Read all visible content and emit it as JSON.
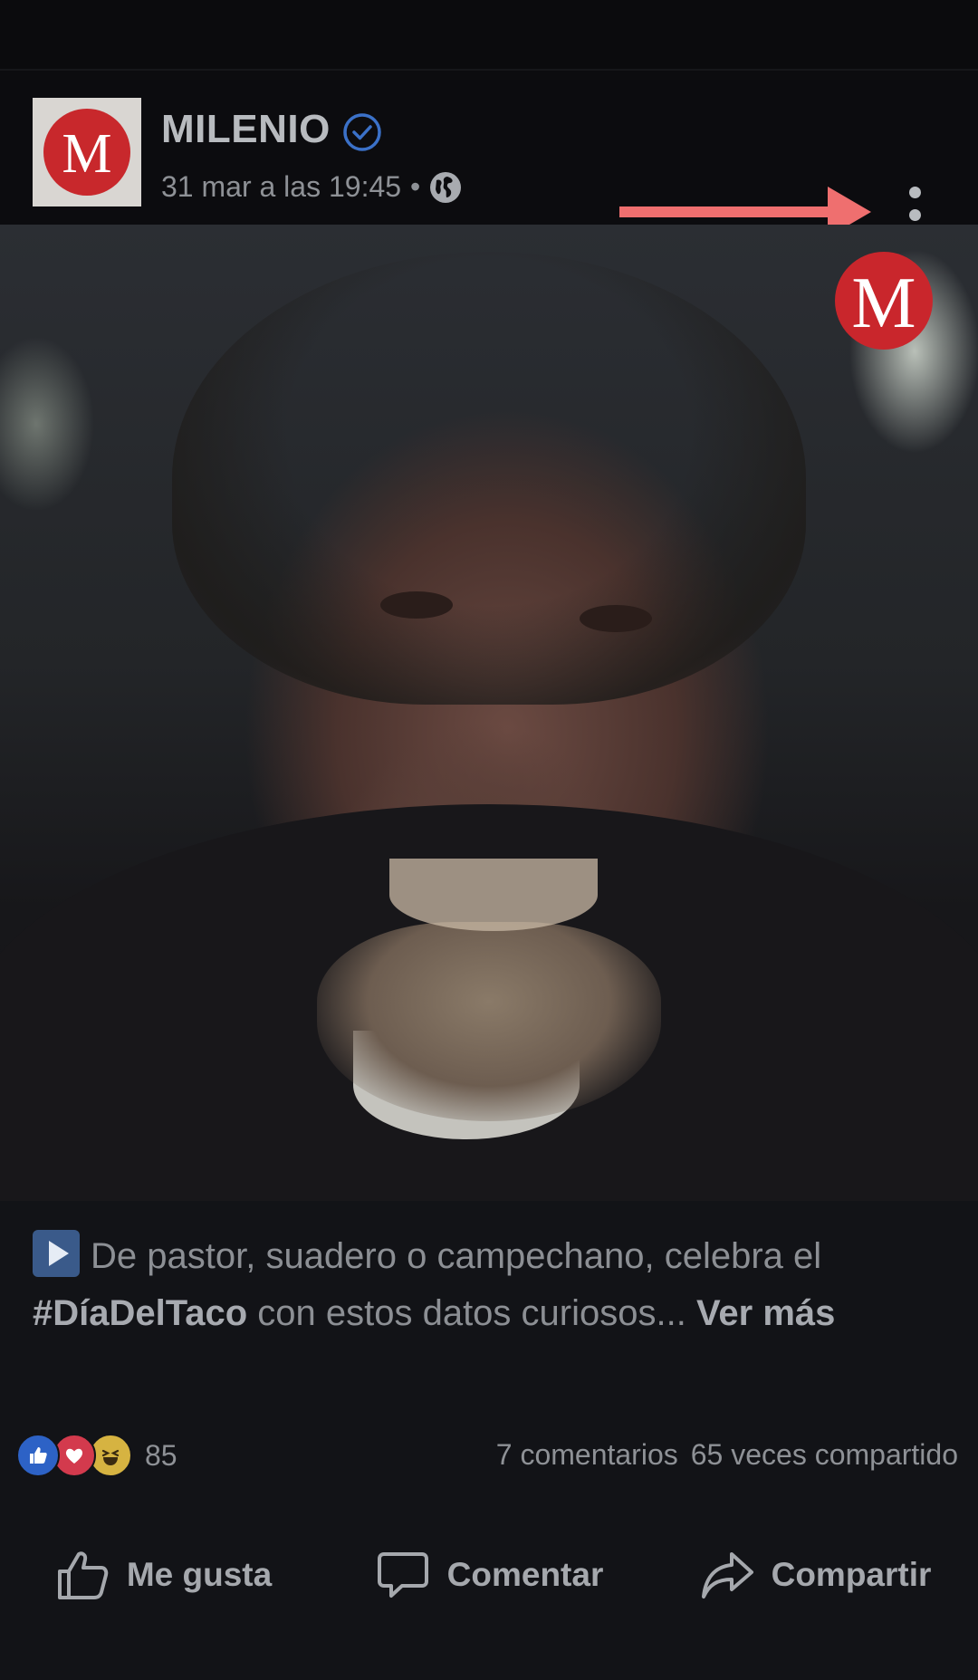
{
  "post": {
    "page_name": "MILENIO",
    "avatar_letter": "M",
    "timestamp": "31 mar a las 19:45",
    "separator": "•",
    "privacy_icon": "globe-icon",
    "verified_icon": "verified-badge-icon",
    "annotation": "arrow-pointer-to-more-options"
  },
  "media": {
    "watermark_letter": "M",
    "description": ""
  },
  "caption": {
    "play_icon": "play-emoji-icon",
    "text_before": "De pastor, suadero o campechano, celebra el ",
    "hashtag": "#DíaDelTaco",
    "text_after": " con estos datos curiosos... ",
    "see_more": "Ver más"
  },
  "engagement": {
    "reactions": [
      "like-reaction-icon",
      "love-reaction-icon",
      "haha-reaction-icon"
    ],
    "reaction_count": "85",
    "comments": "7 comentarios",
    "shares": "65 veces compartido"
  },
  "actions": {
    "like": "Me gusta",
    "comment": "Comentar",
    "share": "Compartir"
  },
  "colors": {
    "background": "#0c0d10",
    "brand_red": "#c9262c",
    "verified_blue": "#3b71c8",
    "annotation_arrow": "#ef6f6f"
  }
}
